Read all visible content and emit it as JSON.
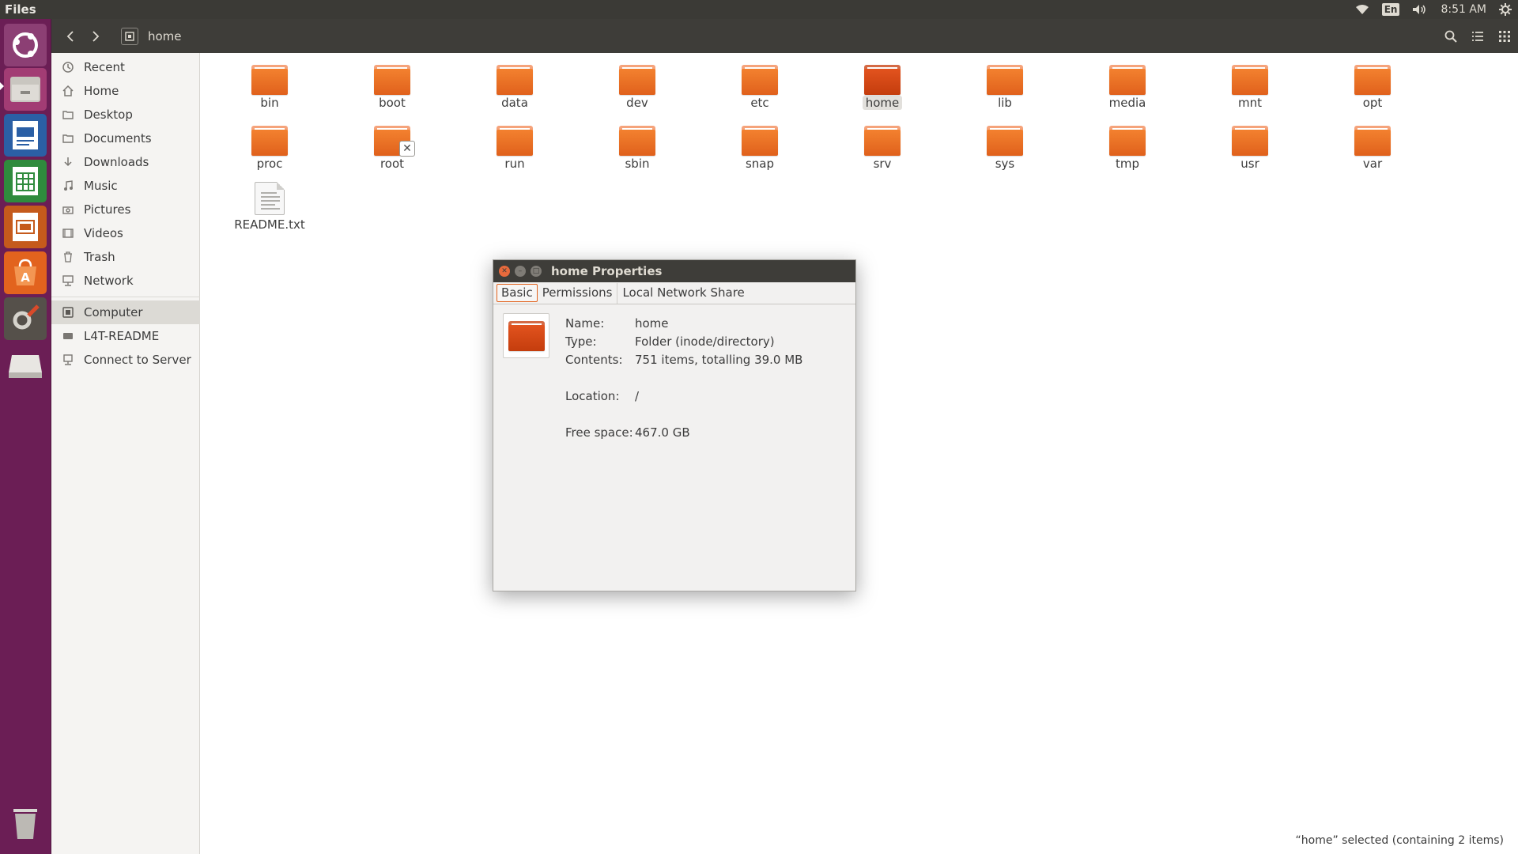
{
  "top_panel": {
    "app_name": "Files",
    "lang": "En",
    "clock": "8:51 AM",
    "icons": [
      "wifi-icon",
      "keyboard-language-icon",
      "volume-icon",
      "system-menu-icon"
    ]
  },
  "launcher": {
    "items": [
      "ubuntu-dash",
      "files",
      "libreoffice-writer",
      "libreoffice-calc",
      "libreoffice-impress",
      "ubuntu-software",
      "system-settings",
      "removable-drive",
      "trash"
    ]
  },
  "header": {
    "path": "home"
  },
  "sidebar": {
    "places": [
      {
        "label": "Recent",
        "icon": "clock-icon"
      },
      {
        "label": "Home",
        "icon": "home-icon"
      },
      {
        "label": "Desktop",
        "icon": "folder-icon"
      },
      {
        "label": "Documents",
        "icon": "document-icon"
      },
      {
        "label": "Downloads",
        "icon": "download-icon"
      },
      {
        "label": "Music",
        "icon": "music-icon"
      },
      {
        "label": "Pictures",
        "icon": "camera-icon"
      },
      {
        "label": "Videos",
        "icon": "video-icon"
      },
      {
        "label": "Trash",
        "icon": "trash-icon"
      },
      {
        "label": "Network",
        "icon": "network-icon"
      }
    ],
    "devices": [
      {
        "label": "Computer",
        "icon": "computer-icon"
      },
      {
        "label": "L4T-README",
        "icon": "drive-icon"
      },
      {
        "label": "Connect to Server",
        "icon": "server-icon"
      }
    ]
  },
  "files": [
    {
      "name": "bin"
    },
    {
      "name": "boot"
    },
    {
      "name": "data"
    },
    {
      "name": "dev"
    },
    {
      "name": "etc"
    },
    {
      "name": "home"
    },
    {
      "name": "lib"
    },
    {
      "name": "media"
    },
    {
      "name": "mnt"
    },
    {
      "name": "opt"
    },
    {
      "name": "proc"
    },
    {
      "name": "root"
    },
    {
      "name": "run"
    },
    {
      "name": "sbin"
    },
    {
      "name": "snap"
    },
    {
      "name": "srv"
    },
    {
      "name": "sys"
    },
    {
      "name": "tmp"
    },
    {
      "name": "usr"
    },
    {
      "name": "var"
    },
    {
      "name": "README.txt"
    }
  ],
  "status": "“home” selected  (containing 2 items)",
  "dialog": {
    "title": "home Properties",
    "tabs": [
      "Basic",
      "Permissions",
      "Local Network Share"
    ],
    "props": {
      "name_key": "Name:",
      "name_val": "home",
      "type_key": "Type:",
      "type_val": "Folder (inode/directory)",
      "contents_key": "Contents:",
      "contents_val": "751 items, totalling 39.0 MB",
      "location_key": "Location:",
      "location_val": "/",
      "free_key": "Free space:",
      "free_val": "467.0 GB"
    }
  }
}
